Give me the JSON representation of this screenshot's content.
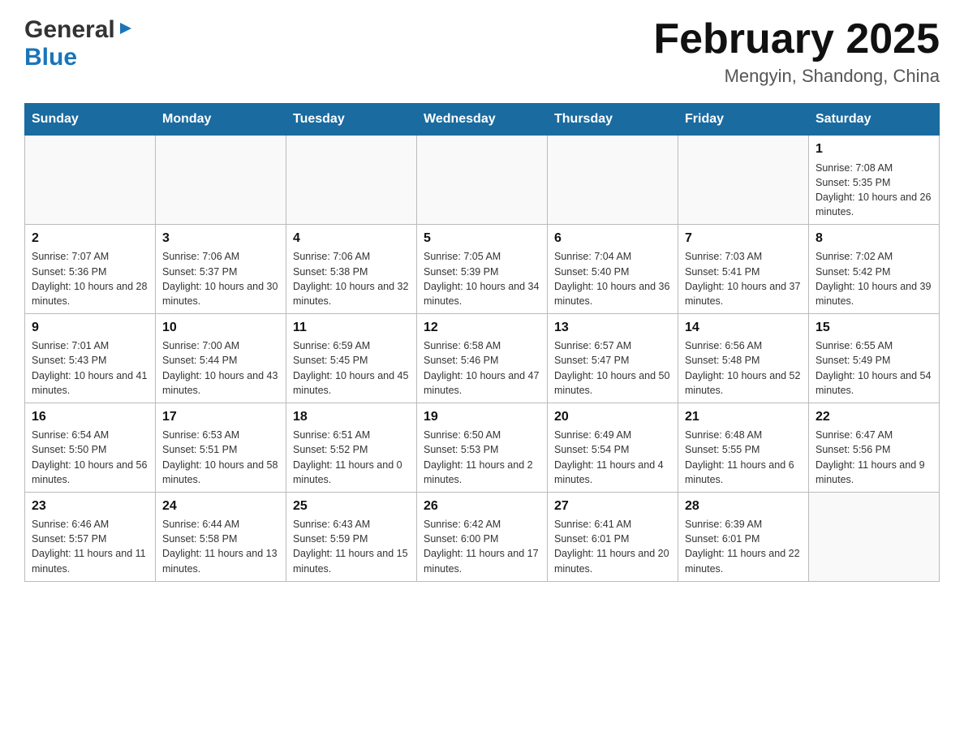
{
  "header": {
    "logo_general": "General",
    "logo_blue": "Blue",
    "month_title": "February 2025",
    "location": "Mengyin, Shandong, China"
  },
  "days_of_week": [
    "Sunday",
    "Monday",
    "Tuesday",
    "Wednesday",
    "Thursday",
    "Friday",
    "Saturday"
  ],
  "weeks": [
    [
      {
        "day": "",
        "info": ""
      },
      {
        "day": "",
        "info": ""
      },
      {
        "day": "",
        "info": ""
      },
      {
        "day": "",
        "info": ""
      },
      {
        "day": "",
        "info": ""
      },
      {
        "day": "",
        "info": ""
      },
      {
        "day": "1",
        "info": "Sunrise: 7:08 AM\nSunset: 5:35 PM\nDaylight: 10 hours and 26 minutes."
      }
    ],
    [
      {
        "day": "2",
        "info": "Sunrise: 7:07 AM\nSunset: 5:36 PM\nDaylight: 10 hours and 28 minutes."
      },
      {
        "day": "3",
        "info": "Sunrise: 7:06 AM\nSunset: 5:37 PM\nDaylight: 10 hours and 30 minutes."
      },
      {
        "day": "4",
        "info": "Sunrise: 7:06 AM\nSunset: 5:38 PM\nDaylight: 10 hours and 32 minutes."
      },
      {
        "day": "5",
        "info": "Sunrise: 7:05 AM\nSunset: 5:39 PM\nDaylight: 10 hours and 34 minutes."
      },
      {
        "day": "6",
        "info": "Sunrise: 7:04 AM\nSunset: 5:40 PM\nDaylight: 10 hours and 36 minutes."
      },
      {
        "day": "7",
        "info": "Sunrise: 7:03 AM\nSunset: 5:41 PM\nDaylight: 10 hours and 37 minutes."
      },
      {
        "day": "8",
        "info": "Sunrise: 7:02 AM\nSunset: 5:42 PM\nDaylight: 10 hours and 39 minutes."
      }
    ],
    [
      {
        "day": "9",
        "info": "Sunrise: 7:01 AM\nSunset: 5:43 PM\nDaylight: 10 hours and 41 minutes."
      },
      {
        "day": "10",
        "info": "Sunrise: 7:00 AM\nSunset: 5:44 PM\nDaylight: 10 hours and 43 minutes."
      },
      {
        "day": "11",
        "info": "Sunrise: 6:59 AM\nSunset: 5:45 PM\nDaylight: 10 hours and 45 minutes."
      },
      {
        "day": "12",
        "info": "Sunrise: 6:58 AM\nSunset: 5:46 PM\nDaylight: 10 hours and 47 minutes."
      },
      {
        "day": "13",
        "info": "Sunrise: 6:57 AM\nSunset: 5:47 PM\nDaylight: 10 hours and 50 minutes."
      },
      {
        "day": "14",
        "info": "Sunrise: 6:56 AM\nSunset: 5:48 PM\nDaylight: 10 hours and 52 minutes."
      },
      {
        "day": "15",
        "info": "Sunrise: 6:55 AM\nSunset: 5:49 PM\nDaylight: 10 hours and 54 minutes."
      }
    ],
    [
      {
        "day": "16",
        "info": "Sunrise: 6:54 AM\nSunset: 5:50 PM\nDaylight: 10 hours and 56 minutes."
      },
      {
        "day": "17",
        "info": "Sunrise: 6:53 AM\nSunset: 5:51 PM\nDaylight: 10 hours and 58 minutes."
      },
      {
        "day": "18",
        "info": "Sunrise: 6:51 AM\nSunset: 5:52 PM\nDaylight: 11 hours and 0 minutes."
      },
      {
        "day": "19",
        "info": "Sunrise: 6:50 AM\nSunset: 5:53 PM\nDaylight: 11 hours and 2 minutes."
      },
      {
        "day": "20",
        "info": "Sunrise: 6:49 AM\nSunset: 5:54 PM\nDaylight: 11 hours and 4 minutes."
      },
      {
        "day": "21",
        "info": "Sunrise: 6:48 AM\nSunset: 5:55 PM\nDaylight: 11 hours and 6 minutes."
      },
      {
        "day": "22",
        "info": "Sunrise: 6:47 AM\nSunset: 5:56 PM\nDaylight: 11 hours and 9 minutes."
      }
    ],
    [
      {
        "day": "23",
        "info": "Sunrise: 6:46 AM\nSunset: 5:57 PM\nDaylight: 11 hours and 11 minutes."
      },
      {
        "day": "24",
        "info": "Sunrise: 6:44 AM\nSunset: 5:58 PM\nDaylight: 11 hours and 13 minutes."
      },
      {
        "day": "25",
        "info": "Sunrise: 6:43 AM\nSunset: 5:59 PM\nDaylight: 11 hours and 15 minutes."
      },
      {
        "day": "26",
        "info": "Sunrise: 6:42 AM\nSunset: 6:00 PM\nDaylight: 11 hours and 17 minutes."
      },
      {
        "day": "27",
        "info": "Sunrise: 6:41 AM\nSunset: 6:01 PM\nDaylight: 11 hours and 20 minutes."
      },
      {
        "day": "28",
        "info": "Sunrise: 6:39 AM\nSunset: 6:01 PM\nDaylight: 11 hours and 22 minutes."
      },
      {
        "day": "",
        "info": ""
      }
    ]
  ]
}
